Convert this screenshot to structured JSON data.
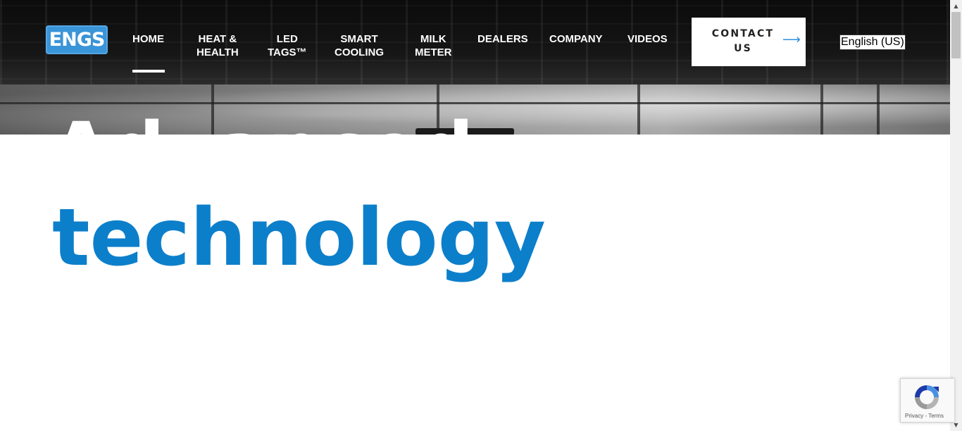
{
  "brand": {
    "logo_text": "ENGS",
    "accent": "#0c7fcb",
    "logo_bg": "#3a94d8"
  },
  "nav": {
    "items": [
      {
        "label": "HOME",
        "active": true
      },
      {
        "label": "HEAT &\nHEALTH"
      },
      {
        "label": "LED\nTAGS™"
      },
      {
        "label": "SMART\nCOOLING"
      },
      {
        "label": "MILK\nMETER"
      },
      {
        "label": "DEALERS"
      },
      {
        "label": "COMPANY"
      },
      {
        "label": "VIDEOS"
      }
    ],
    "contact": {
      "label": "CONTACT\nUS",
      "icon": "arrow-right-icon"
    },
    "language": {
      "selected": "English (US)"
    }
  },
  "hero": {
    "heading_top_partial": "Advanced",
    "headline": "technology"
  },
  "recaptcha": {
    "links": "Privacy - Terms"
  }
}
